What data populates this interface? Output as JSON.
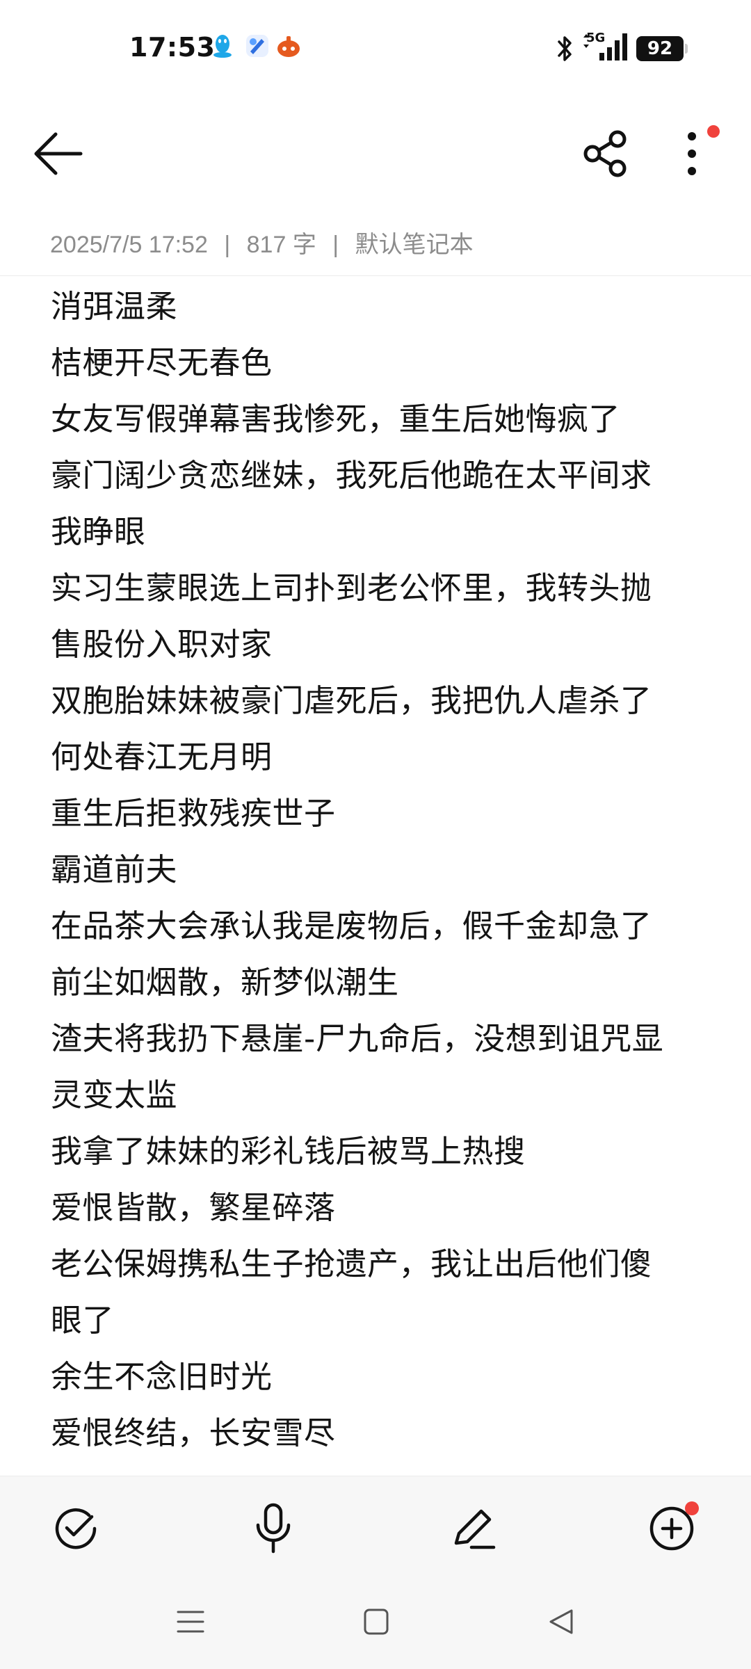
{
  "status_bar": {
    "time": "17:53",
    "network": "5G",
    "battery": "92",
    "icons": [
      "qq-penguin-icon",
      "blue-app-icon",
      "orange-app-icon",
      "bluetooth-icon",
      "signal-icon"
    ]
  },
  "app_bar": {
    "back_icon": "arrow-left-icon",
    "share_icon": "share-icon",
    "more_icon": "more-vertical-icon",
    "more_badge_color": "#f0423c"
  },
  "meta": {
    "datetime": "2025/7/5 17:52",
    "word_count": "817 字",
    "notebook": "默认笔记本"
  },
  "note": {
    "lines": [
      "消弭温柔",
      "桔梗开尽无春色",
      "女友写假弹幕害我惨死，重生后她悔疯了",
      "豪门阔少贪恋继妹，我死后他跪在太平间求",
      "我睁眼",
      "实习生蒙眼选上司扑到老公怀里，我转头抛",
      "售股份入职对家",
      "双胞胎妹妹被豪门虐死后，我把仇人虐杀了",
      "何处春江无月明",
      "重生后拒救残疾世子",
      "霸道前夫",
      "在品茶大会承认我是废物后，假千金却急了",
      "前尘如烟散，新梦似潮生",
      "渣夫将我扔下悬崖-尸九命后，没想到诅咒显",
      "灵变太监",
      "我拿了妹妹的彩礼钱后被骂上热搜",
      "爱恨皆散，繁星碎落",
      "老公保姆携私生子抢遗产，我让出后他们傻",
      "眼了",
      "余生不念旧时光",
      "爱恨终结，长安雪尽"
    ]
  },
  "toolbar": {
    "items": [
      "checklist-icon",
      "microphone-icon",
      "pen-icon",
      "add-circle-icon"
    ],
    "add_badge_color": "#f0423c"
  },
  "nav_bar": {
    "items": [
      "menu-icon",
      "home-icon",
      "back-triangle-icon"
    ]
  }
}
